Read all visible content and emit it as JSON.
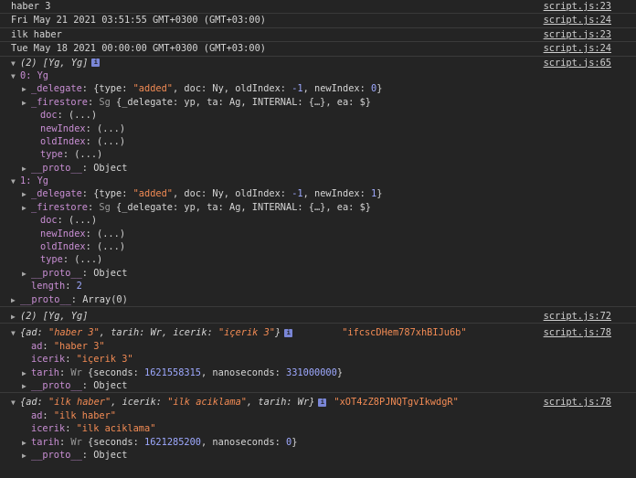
{
  "logs": [
    {
      "text": "haber 3",
      "source": "script.js:23"
    },
    {
      "text": "Fri May 21 2021 03:51:55 GMT+0300 (GMT+03:00)",
      "source": "script.js:24"
    },
    {
      "text": "ilk haber",
      "source": "script.js:23"
    },
    {
      "text": "Tue May 18 2021 00:00:00 GMT+0300 (GMT+03:00)",
      "source": "script.js:24"
    }
  ],
  "array_log": {
    "summary": "(2) [Yg, Yg]",
    "source": "script.js:65",
    "items": [
      {
        "index_label": "0: Yg",
        "delegate_key": "_delegate",
        "delegate_value_prefix": "{type: ",
        "delegate_type": "\"added\"",
        "delegate_mid": ", doc: Ny, oldIndex: ",
        "delegate_oldindex": "-1",
        "delegate_mid2": ", newIndex: ",
        "delegate_newindex": "0",
        "delegate_end": "}",
        "firestore_key": "_firestore",
        "firestore_cls": "Sg",
        "firestore_value": " {_delegate: yp, ta: Ag, INTERNAL: {…}, ea: $}",
        "doc_key": "doc",
        "newindex_key": "newIndex",
        "oldindex_key": "oldIndex",
        "type_key": "type",
        "getter": "(...)",
        "proto_key": "__proto__",
        "proto_value": "Object"
      },
      {
        "index_label": "1: Yg",
        "delegate_key": "_delegate",
        "delegate_value_prefix": "{type: ",
        "delegate_type": "\"added\"",
        "delegate_mid": ", doc: Ny, oldIndex: ",
        "delegate_oldindex": "-1",
        "delegate_mid2": ", newIndex: ",
        "delegate_newindex": "1",
        "delegate_end": "}",
        "firestore_key": "_firestore",
        "firestore_cls": "Sg",
        "firestore_value": " {_delegate: yp, ta: Ag, INTERNAL: {…}, ea: $}",
        "doc_key": "doc",
        "newindex_key": "newIndex",
        "oldindex_key": "oldIndex",
        "type_key": "type",
        "getter": "(...)",
        "proto_key": "__proto__",
        "proto_value": "Object"
      }
    ],
    "length_key": "length",
    "length_value": "2",
    "array_proto_key": "__proto__",
    "array_proto_value": "Array(0)"
  },
  "collapsed_log": {
    "summary": "(2) [Yg, Yg]",
    "source": "script.js:72"
  },
  "objects": [
    {
      "summary_open": "{ad: ",
      "summary_ad": "\"haber 3\"",
      "summary_mid": ", tarih: Wr, icerik: ",
      "summary_icerik": "\"içerik 3\"",
      "summary_close": "}",
      "id_string": "\"ifcscDHem787xhBIJu6b\"",
      "source": "script.js:78",
      "ad_key": "ad",
      "ad_value": "\"haber 3\"",
      "icerik_key": "icerik",
      "icerik_value": "\"içerik 3\"",
      "tarih_key": "tarih",
      "tarih_cls": "Wr",
      "tarih_open": " {seconds: ",
      "seconds": "1621558315",
      "tarih_mid": ", nanoseconds: ",
      "nanoseconds": "331000000",
      "tarih_close": "}",
      "proto_key": "__proto__",
      "proto_value": "Object"
    },
    {
      "summary_open": "{ad: ",
      "summary_ad": "\"ilk haber\"",
      "summary_mid": ", icerik: ",
      "summary_icerik": "\"ilk aciklama\"",
      "summary_close": ", tarih: Wr}",
      "id_string": "\"xOT4zZ8PJNQTgvIkwdgR\"",
      "source": "script.js:78",
      "ad_key": "ad",
      "ad_value": "\"ilk haber\"",
      "icerik_key": "icerik",
      "icerik_value": "\"ilk aciklama\"",
      "tarih_key": "tarih",
      "tarih_cls": "Wr",
      "tarih_open": " {seconds: ",
      "seconds": "1621285200",
      "tarih_mid": ", nanoseconds: ",
      "nanoseconds": "0",
      "tarih_close": "}",
      "proto_key": "__proto__",
      "proto_value": "Object"
    }
  ],
  "icons": {
    "expand": "triangle-down-icon",
    "collapse": "triangle-right-icon",
    "info": "info-icon"
  }
}
